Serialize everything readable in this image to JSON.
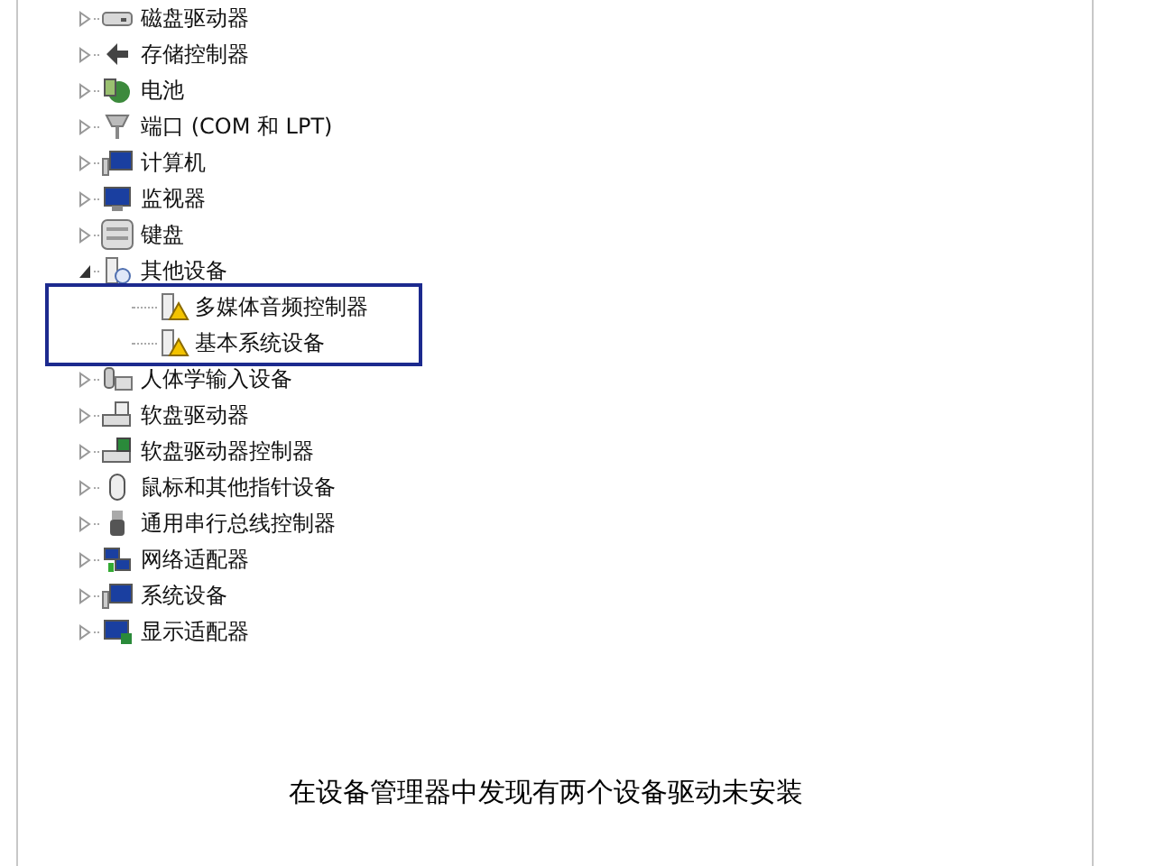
{
  "tree": [
    {
      "label": "磁盘驱动器",
      "expanded": false
    },
    {
      "label": "存储控制器",
      "expanded": false
    },
    {
      "label": "电池",
      "expanded": false
    },
    {
      "label": "端口 (COM 和 LPT)",
      "expanded": false
    },
    {
      "label": "计算机",
      "expanded": false
    },
    {
      "label": "监视器",
      "expanded": false
    },
    {
      "label": "键盘",
      "expanded": false
    },
    {
      "label": "其他设备",
      "expanded": true,
      "highlighted": true,
      "children": [
        {
          "label": "多媒体音频控制器",
          "warning": true
        },
        {
          "label": "基本系统设备",
          "warning": true
        }
      ]
    },
    {
      "label": "人体学输入设备",
      "expanded": false
    },
    {
      "label": "软盘驱动器",
      "expanded": false
    },
    {
      "label": "软盘驱动器控制器",
      "expanded": false
    },
    {
      "label": "鼠标和其他指针设备",
      "expanded": false
    },
    {
      "label": "通用串行总线控制器",
      "expanded": false
    },
    {
      "label": "网络适配器",
      "expanded": false
    },
    {
      "label": "系统设备",
      "expanded": false
    },
    {
      "label": "显示适配器",
      "expanded": false
    }
  ],
  "caption": "在设备管理器中发现有两个设备驱动未安装"
}
